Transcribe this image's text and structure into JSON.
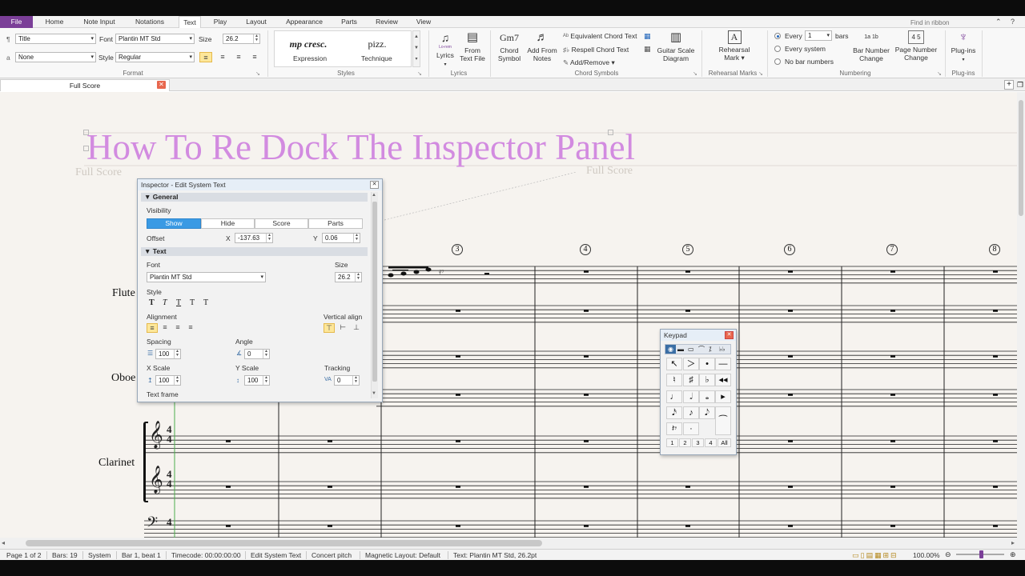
{
  "menu": {
    "file": "File",
    "tabs": [
      "Home",
      "Note Input",
      "Notations",
      "Text",
      "Play",
      "Layout",
      "Appearance",
      "Parts",
      "Review",
      "View"
    ],
    "find_placeholder": "Find in ribbon"
  },
  "format": {
    "style_value": "Title",
    "font_label": "Font",
    "font_value": "Plantin MT Std",
    "size_label": "Size",
    "size_value": "26.2",
    "char_value": "None",
    "char_style_label": "Style",
    "char_style_value": "Regular",
    "group": "Format"
  },
  "styles": {
    "item1_sample": "mp cresc.",
    "item1_name": "Expression",
    "item2_sample": "pizz.",
    "item2_name": "Technique",
    "group": "Styles"
  },
  "lyrics": {
    "lyrics": "Lyrics",
    "lyrics_icon": "Lo-rem",
    "from_text": "From",
    "from_text2": "Text File",
    "group": "Lyrics"
  },
  "chords": {
    "gm7": "Gm7",
    "chord": "Chord",
    "symbol": "Symbol",
    "addfrom": "Add From",
    "notes": "Notes",
    "equiv": "Equivalent Chord Text",
    "respell": "Respell Chord Text",
    "addremove": "Add/Remove",
    "guitar": "Guitar Scale",
    "diagram": "Diagram",
    "group": "Chord Symbols"
  },
  "rehearsal": {
    "label": "Rehearsal",
    "label2": "Mark",
    "icon": "A",
    "group": "Rehearsal Marks"
  },
  "numbering": {
    "every": "Every",
    "every_val": "1",
    "bars": "bars",
    "every_system": "Every system",
    "no_bar": "No bar numbers",
    "bnc": "Bar Number",
    "bnc2": "Change",
    "bnc_icon": "1a 1b",
    "pnc": "Page Number",
    "pnc2": "Change",
    "pnc_icon": "4 5",
    "group": "Numbering"
  },
  "plugins": {
    "label": "Plug-ins",
    "group": "Plug-ins"
  },
  "doc_tab": "Full Score",
  "score": {
    "title": "How To Re Dock The Inspector Panel",
    "watermark": "Full Score",
    "instruments": [
      "Flute",
      "Oboe",
      "Clarinet"
    ],
    "bar_numbers": [
      "3",
      "4",
      "5",
      "6",
      "7",
      "8"
    ],
    "clef": "𝄞",
    "bass_clef": "𝄢",
    "time_sig": "4"
  },
  "inspector": {
    "title": "Inspector - Edit System Text",
    "general": "General",
    "visibility": "Visibility",
    "vis_options": [
      "Show",
      "Hide",
      "Score",
      "Parts"
    ],
    "offset": "Offset",
    "x_label": "X",
    "x_value": "-137.63",
    "y_label": "Y",
    "y_value": "0.06",
    "text_section": "Text",
    "font": "Font",
    "size": "Size",
    "font_value": "Plantin MT Std",
    "size_value": "26.2",
    "style": "Style",
    "style_glyphs": [
      "T",
      "T",
      "T",
      "T",
      "T"
    ],
    "alignment": "Alignment",
    "valign": "Vertical align",
    "spacing": "Spacing",
    "spacing_value": "100",
    "angle": "Angle",
    "angle_value": "0",
    "xscale": "X Scale",
    "xscale_value": "100",
    "yscale": "Y Scale",
    "yscale_value": "100",
    "tracking": "Tracking",
    "tracking_value": "0",
    "text_frame": "Text frame"
  },
  "keypad": {
    "title": "Keypad",
    "rows": [
      [
        "↖",
        "＞",
        "•",
        "—"
      ],
      [
        "♮",
        "♯",
        "♭",
        "◂◂"
      ],
      [
        "♩",
        "𝅗𝅥",
        "𝅝",
        "▸"
      ],
      [
        "𝅘𝅥𝅯",
        "♪",
        "𝅘𝅥𝅮",
        ""
      ],
      [
        "𝄽𝄾",
        "·",
        "",
        ""
      ]
    ],
    "layouts": [
      "1",
      "2",
      "3",
      "4",
      "All"
    ]
  },
  "status": {
    "page": "Page 1 of 2",
    "bars": "Bars: 19",
    "system": "System",
    "position": "Bar 1, beat 1",
    "timecode": "Timecode: 00:00:00:00",
    "mode": "Edit System Text",
    "pitch": "Concert pitch",
    "magnetic": "Magnetic Layout: Default",
    "text": "Text: Plantin MT Std, 26.2pt",
    "zoom": "100.00%"
  },
  "colors": {
    "accent": "#7b3f98",
    "title_pink": "#d28be0",
    "visibility_on": "#3a9ae4"
  }
}
